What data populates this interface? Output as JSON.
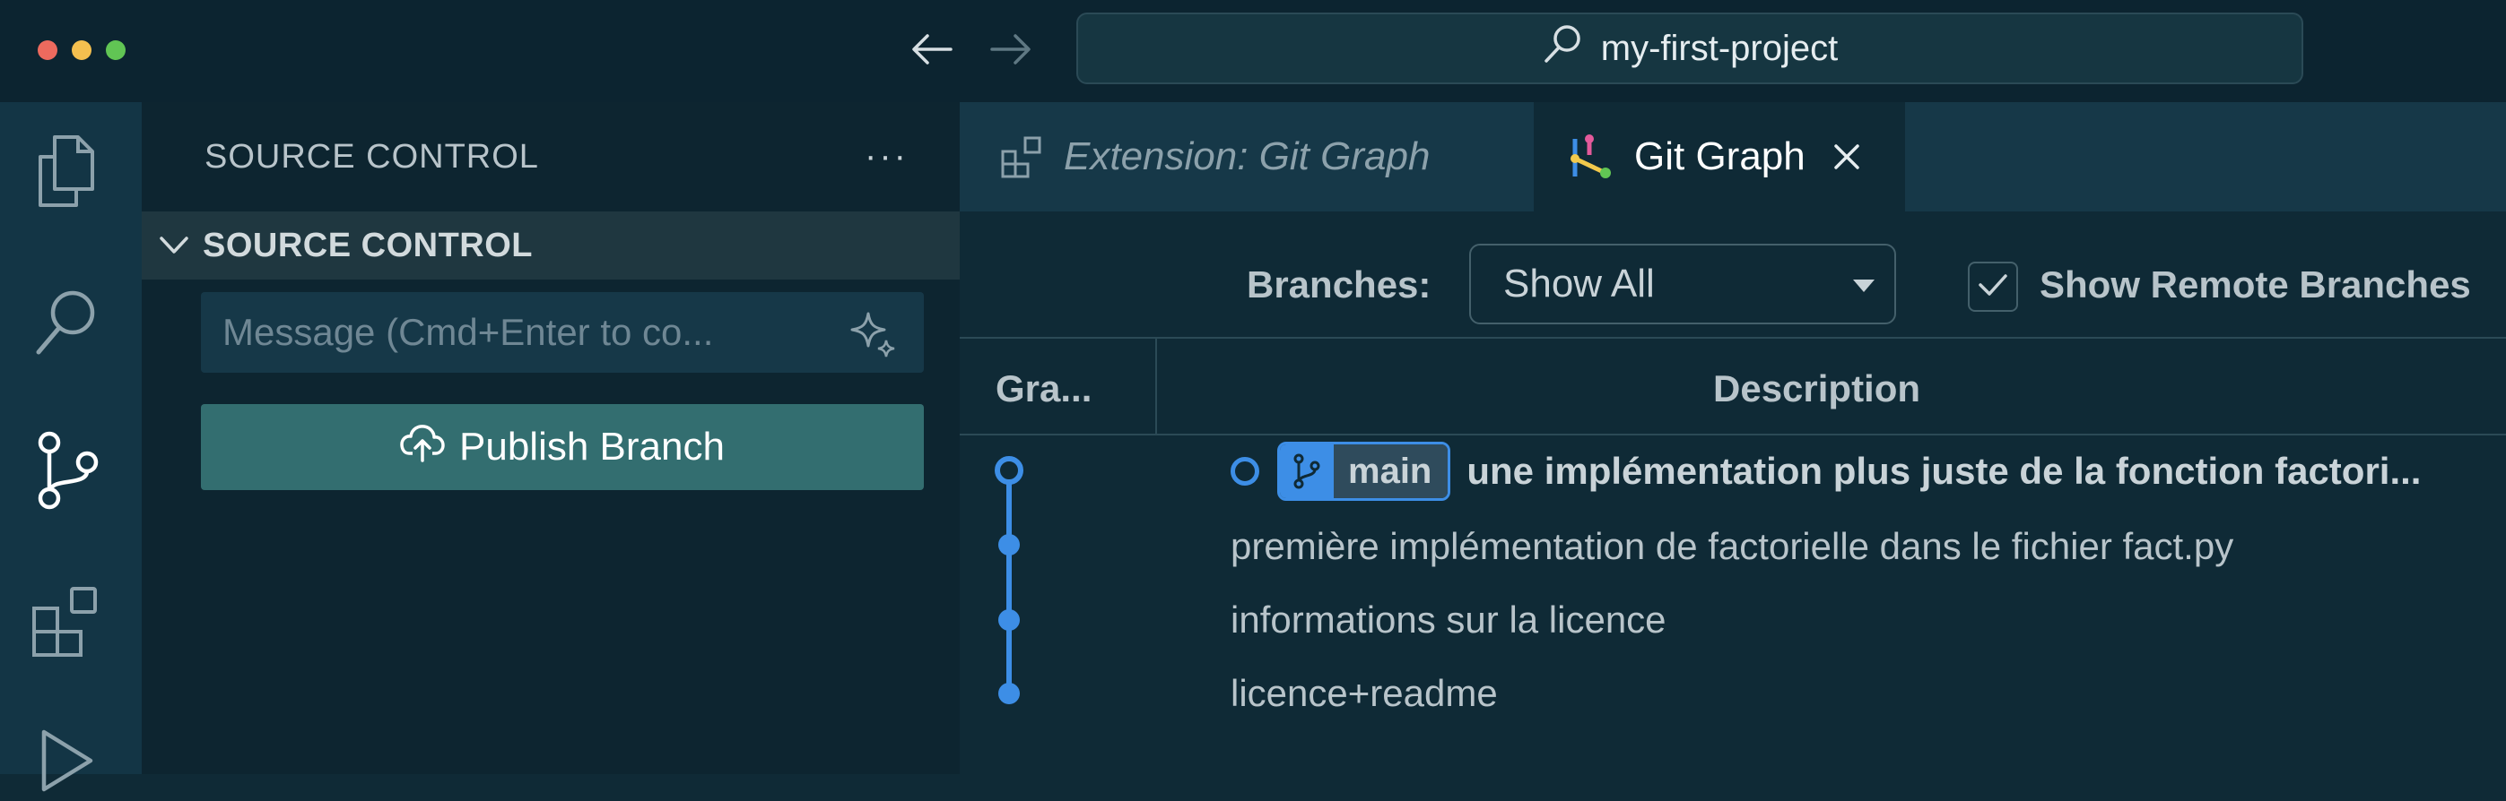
{
  "titlebar": {
    "search_text": "my-first-project"
  },
  "sidebar": {
    "title": "SOURCE CONTROL",
    "more_label": "···",
    "section_label": "SOURCE CONTROL",
    "message_placeholder": "Message (Cmd+Enter to co...",
    "publish_label": "Publish Branch"
  },
  "tabs": [
    {
      "label": "Extension: Git Graph",
      "active": false
    },
    {
      "label": "Git Graph",
      "active": true
    }
  ],
  "controls": {
    "branches_label": "Branches:",
    "branches_value": "Show All",
    "remote_label": "Show Remote Branches",
    "remote_checked": true
  },
  "table": {
    "col_graph": "Gra...",
    "col_description": "Description"
  },
  "commits": [
    {
      "branch": "main",
      "message": "une implémentation plus juste de la fonction factori...",
      "head": true
    },
    {
      "message": "première implémentation de factorielle dans le fichier fact.py"
    },
    {
      "message": "informations sur la licence"
    },
    {
      "message": "licence+readme"
    }
  ],
  "colors": {
    "accent": "#3d8ee6",
    "publish_button": "#336e70",
    "background": "#0f2a36"
  },
  "icons": [
    "back-arrow-icon",
    "forward-arrow-icon",
    "search-icon",
    "explorer-icon",
    "search-icon",
    "source-control-icon",
    "extensions-icon",
    "run-debug-icon",
    "chevron-down-icon",
    "sparkle-icon",
    "cloud-upload-icon",
    "extension-icon",
    "git-graph-icon",
    "close-icon",
    "checkmark-icon",
    "branch-icon"
  ]
}
